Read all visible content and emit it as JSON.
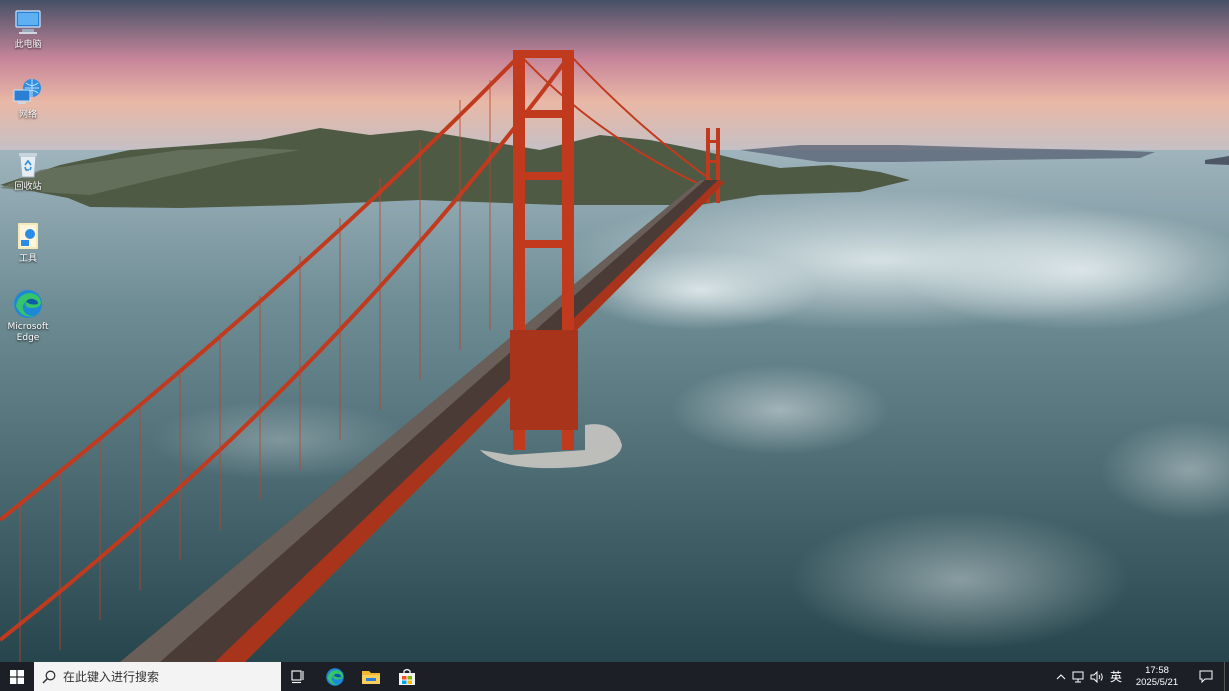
{
  "desktop": {
    "icons": [
      {
        "label": "此电脑",
        "icon": "this-pc-icon"
      },
      {
        "label": "网络",
        "icon": "network-icon"
      },
      {
        "label": "回收站",
        "icon": "recycle-bin-icon"
      },
      {
        "label": "工具",
        "icon": "tools-icon"
      },
      {
        "label": "Microsoft Edge",
        "icon": "edge-icon"
      }
    ]
  },
  "taskbar": {
    "start_icon": "windows-logo-icon",
    "search": {
      "placeholder": "在此键入进行搜索"
    },
    "task_view_icon": "task-view-icon",
    "pinned_apps": [
      {
        "name": "Microsoft Edge",
        "icon": "edge-icon"
      },
      {
        "name": "文件资源管理器",
        "icon": "file-explorer-icon"
      },
      {
        "name": "Microsoft Store",
        "icon": "store-icon"
      }
    ],
    "tray": {
      "ime": "英",
      "time": "17:58",
      "date": "2025/5/21"
    }
  },
  "colors": {
    "taskbar_bg": "#1c1f26",
    "search_bg": "#f3f3f3",
    "bridge_red": "#c23a1e"
  }
}
